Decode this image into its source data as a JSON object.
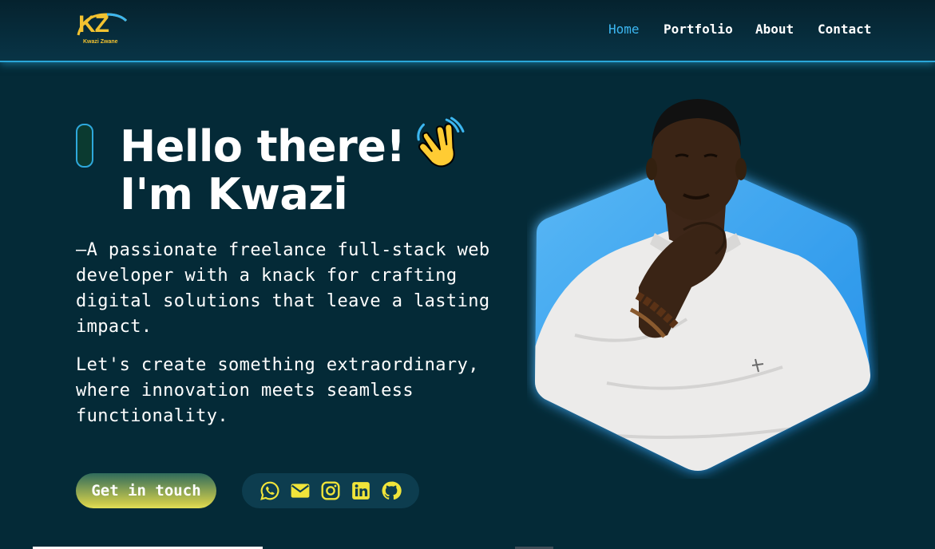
{
  "brand": {
    "logo_text": "KZ",
    "logo_subtitle": "Kwazi Zwane"
  },
  "nav": {
    "items": [
      "Home",
      "Portfolio",
      "About",
      "Contact"
    ],
    "active": "Home"
  },
  "hero": {
    "title_line1": "Hello there!",
    "title_line2": "I'm Kwazi",
    "wave_icon": "waving-hand-icon",
    "intro": "—A passionate freelance full-stack web developer with a knack for crafting digital solutions that leave a lasting impact.",
    "tagline": "Let's create something extraordinary, where innovation meets seamless functionality.",
    "cta_label": "Get in touch"
  },
  "socials": [
    "whatsapp-icon",
    "email-icon",
    "instagram-icon",
    "linkedin-icon",
    "github-icon"
  ],
  "colors": {
    "background": "#042a37",
    "accent_blue": "#3cb6f0",
    "brand_yellow": "#f2c230",
    "social_icon": "#f0e43a"
  }
}
